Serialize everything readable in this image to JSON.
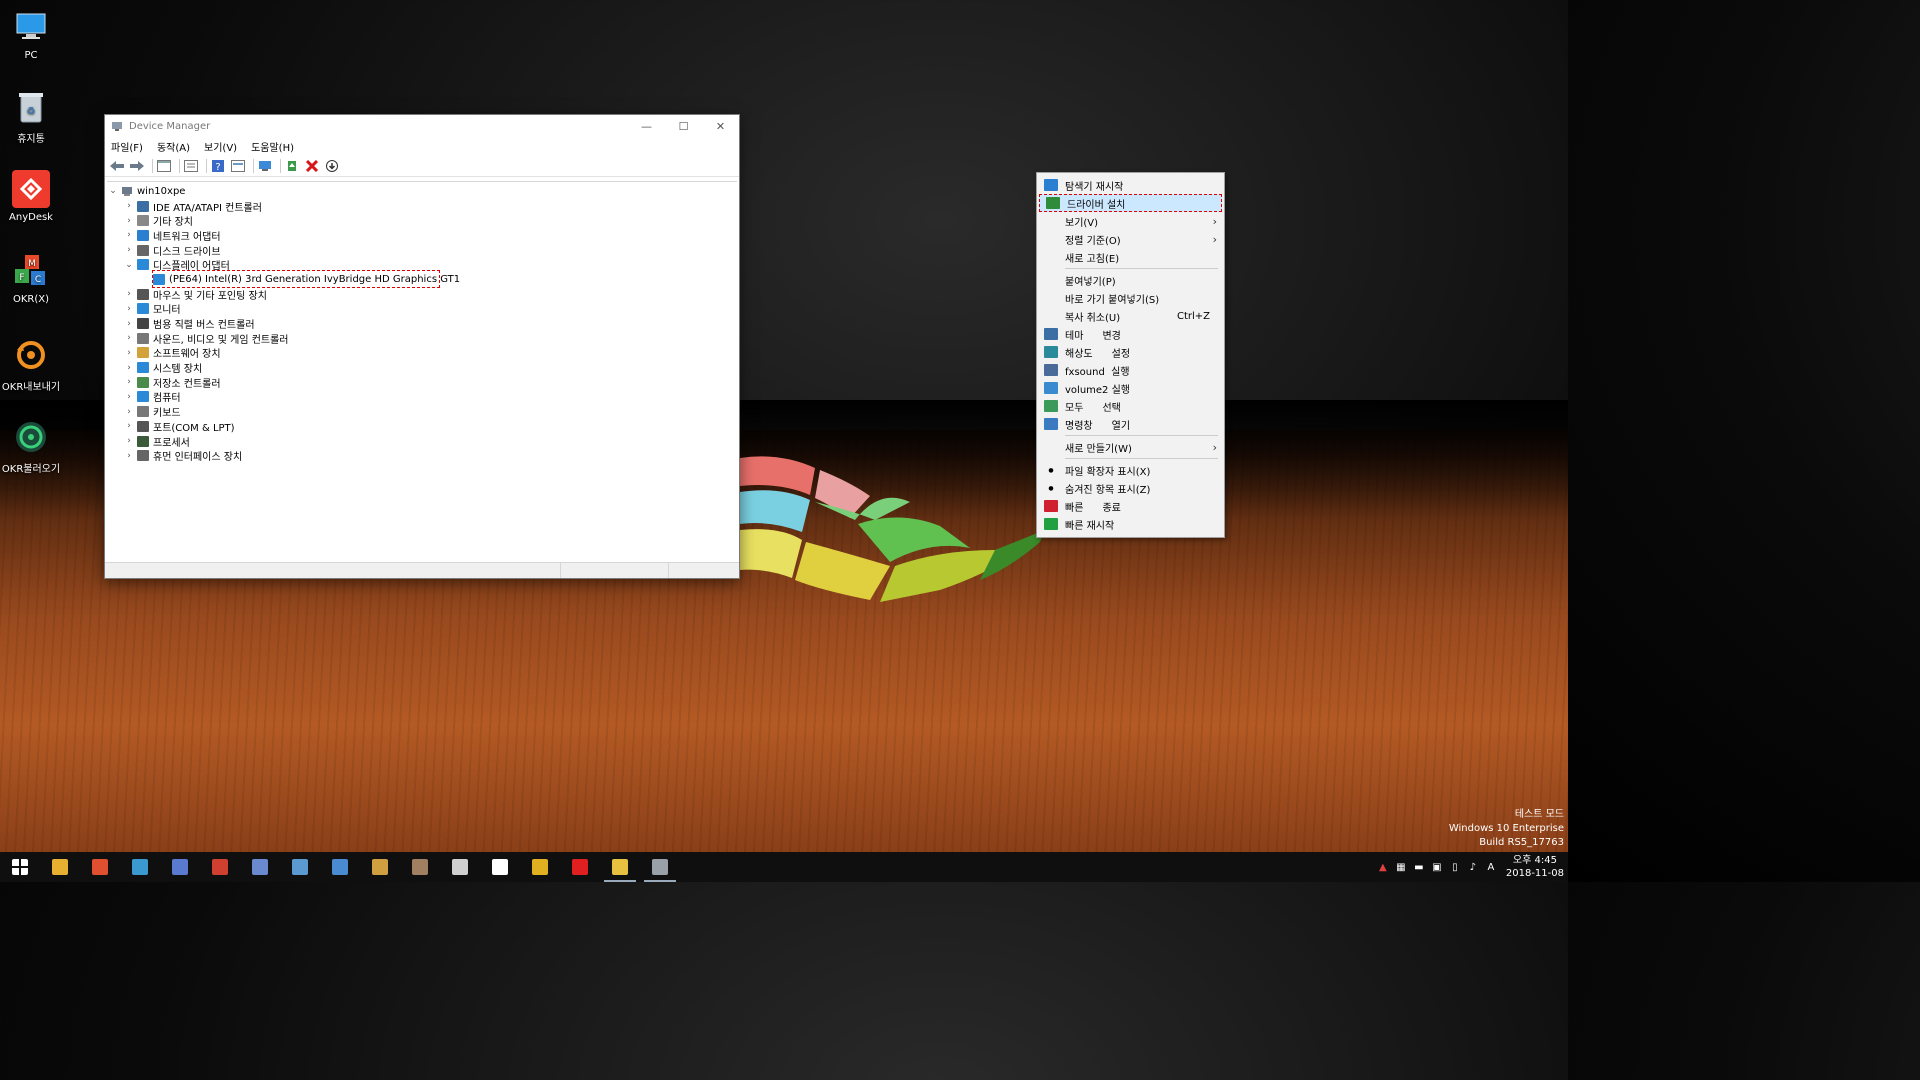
{
  "desktop": {
    "icons": [
      {
        "label": "PC"
      },
      {
        "label": "휴지통"
      },
      {
        "label": "AnyDesk"
      },
      {
        "label": "OKR(X)"
      },
      {
        "label": "OKR내보내기"
      },
      {
        "label": "OKR불러오기"
      }
    ],
    "watermark": {
      "line1": "테스트 모드",
      "line2": "Windows 10 Enterprise",
      "line3": "Build   RS5_17763"
    }
  },
  "window": {
    "title": "Device Manager",
    "controls": {
      "minimize": "—",
      "maximize": "☐",
      "close": "✕"
    },
    "menu": [
      "파일(F)",
      "동작(A)",
      "보기(V)",
      "도움말(H)"
    ],
    "tree": {
      "root": "win10xpe",
      "categories": [
        {
          "label": "IDE ATA/ATAPI 컨트롤러",
          "expanded": false,
          "color": "#3a6ea5"
        },
        {
          "label": "기타 장치",
          "expanded": false,
          "color": "#888888"
        },
        {
          "label": "네트워크 어댑터",
          "expanded": false,
          "color": "#2a7fd0"
        },
        {
          "label": "디스크 드라이브",
          "expanded": false,
          "color": "#666666"
        },
        {
          "label": "디스플레이 어댑터",
          "expanded": true,
          "color": "#2a8ad8"
        },
        {
          "label": "(PE64) Intel(R) 3rd Generation IvyBridge HD Graphics GT1",
          "child": true,
          "color": "#2a8ad8"
        },
        {
          "label": "마우스 및 기타 포인팅 장치",
          "expanded": false,
          "color": "#555555"
        },
        {
          "label": "모니터",
          "expanded": false,
          "color": "#2a8ad8"
        },
        {
          "label": "범용 직렬 버스 컨트롤러",
          "expanded": false,
          "color": "#444444"
        },
        {
          "label": "사운드, 비디오 및 게임 컨트롤러",
          "expanded": false,
          "color": "#777777"
        },
        {
          "label": "소프트웨어 장치",
          "expanded": false,
          "color": "#d4a23a"
        },
        {
          "label": "시스템 장치",
          "expanded": false,
          "color": "#2a8ad8"
        },
        {
          "label": "저장소 컨트롤러",
          "expanded": false,
          "color": "#4a8a4a"
        },
        {
          "label": "컴퓨터",
          "expanded": false,
          "color": "#2a8ad8"
        },
        {
          "label": "키보드",
          "expanded": false,
          "color": "#777777"
        },
        {
          "label": "포트(COM & LPT)",
          "expanded": false,
          "color": "#555555"
        },
        {
          "label": "프로세서",
          "expanded": false,
          "color": "#3a5a3a"
        },
        {
          "label": "휴먼 인터페이스 장치",
          "expanded": false,
          "color": "#666666"
        }
      ]
    }
  },
  "context_menu": {
    "items": [
      {
        "label": "탐색기 재시작",
        "icon": "refresh-icon",
        "color": "#2a7fd0"
      },
      {
        "label": "드라이버 설치",
        "icon": "driver-install-icon",
        "color": "#2f8a3a",
        "highlighted": true
      },
      {
        "label": "보기(V)",
        "submenu": true
      },
      {
        "label": "정렬 기준(O)",
        "submenu": true
      },
      {
        "label": "새로 고침(E)"
      },
      {
        "separator": true
      },
      {
        "label": "붙여넣기(P)"
      },
      {
        "label": "바로 가기 붙여넣기(S)"
      },
      {
        "label": "복사 취소(U)",
        "shortcut": "Ctrl+Z"
      },
      {
        "label": "테마      변경",
        "icon": "theme-icon",
        "color": "#3a6ea5"
      },
      {
        "label": "해상도      설정",
        "icon": "resolution-icon",
        "color": "#2a8a9a"
      },
      {
        "label": "fxsound  실행",
        "icon": "fxsound-icon",
        "color": "#4a6a9a"
      },
      {
        "label": "volume2 실행",
        "icon": "volume-icon",
        "color": "#3a8ad0"
      },
      {
        "label": "모두      선택",
        "icon": "select-all-icon",
        "color": "#3a9a5a"
      },
      {
        "label": "명령창      열기",
        "icon": "cmd-icon",
        "color": "#3a7ac0"
      },
      {
        "separator": true
      },
      {
        "label": "새로 만들기(W)",
        "submenu": true
      },
      {
        "separator": true
      },
      {
        "label": "파일 확장자 표시(X)",
        "bullet": true
      },
      {
        "label": "숨겨진 항목 표시(Z)",
        "bullet": true
      },
      {
        "label": "빠른      종료",
        "icon": "power-icon",
        "color": "#d02030"
      },
      {
        "label": "빠른 재시작",
        "icon": "restart-icon",
        "color": "#20a040"
      }
    ]
  },
  "taskbar": {
    "apps": [
      {
        "name": "start-icon",
        "color": "#ffffff"
      },
      {
        "name": "explorer-icon",
        "color": "#e8b030"
      },
      {
        "name": "puzzle-icon",
        "color": "#e05030"
      },
      {
        "name": "tool-icon",
        "color": "#3a9ad0"
      },
      {
        "name": "globe-icon",
        "color": "#5a7ad0"
      },
      {
        "name": "disk-icon",
        "color": "#d04030"
      },
      {
        "name": "network-icon",
        "color": "#6a8ad0"
      },
      {
        "name": "notepad-icon",
        "color": "#5a9ad0"
      },
      {
        "name": "window-icon",
        "color": "#4a8ad0"
      },
      {
        "name": "box-icon",
        "color": "#d0a040"
      },
      {
        "name": "archive-icon",
        "color": "#a08060"
      },
      {
        "name": "scissors-icon",
        "color": "#d0d0d0"
      },
      {
        "name": "target-icon",
        "color": "#ffffff"
      },
      {
        "name": "chrome-icon",
        "color": "#e0b020"
      },
      {
        "name": "x-icon",
        "color": "#e02020"
      },
      {
        "name": "folder-icon",
        "color": "#e8c040",
        "active": true
      },
      {
        "name": "device-manager-icon",
        "color": "#9aa0a8",
        "active": true
      }
    ],
    "tray": {
      "ime": "A",
      "time": "오후 4:45",
      "date": "2018-11-08"
    }
  }
}
